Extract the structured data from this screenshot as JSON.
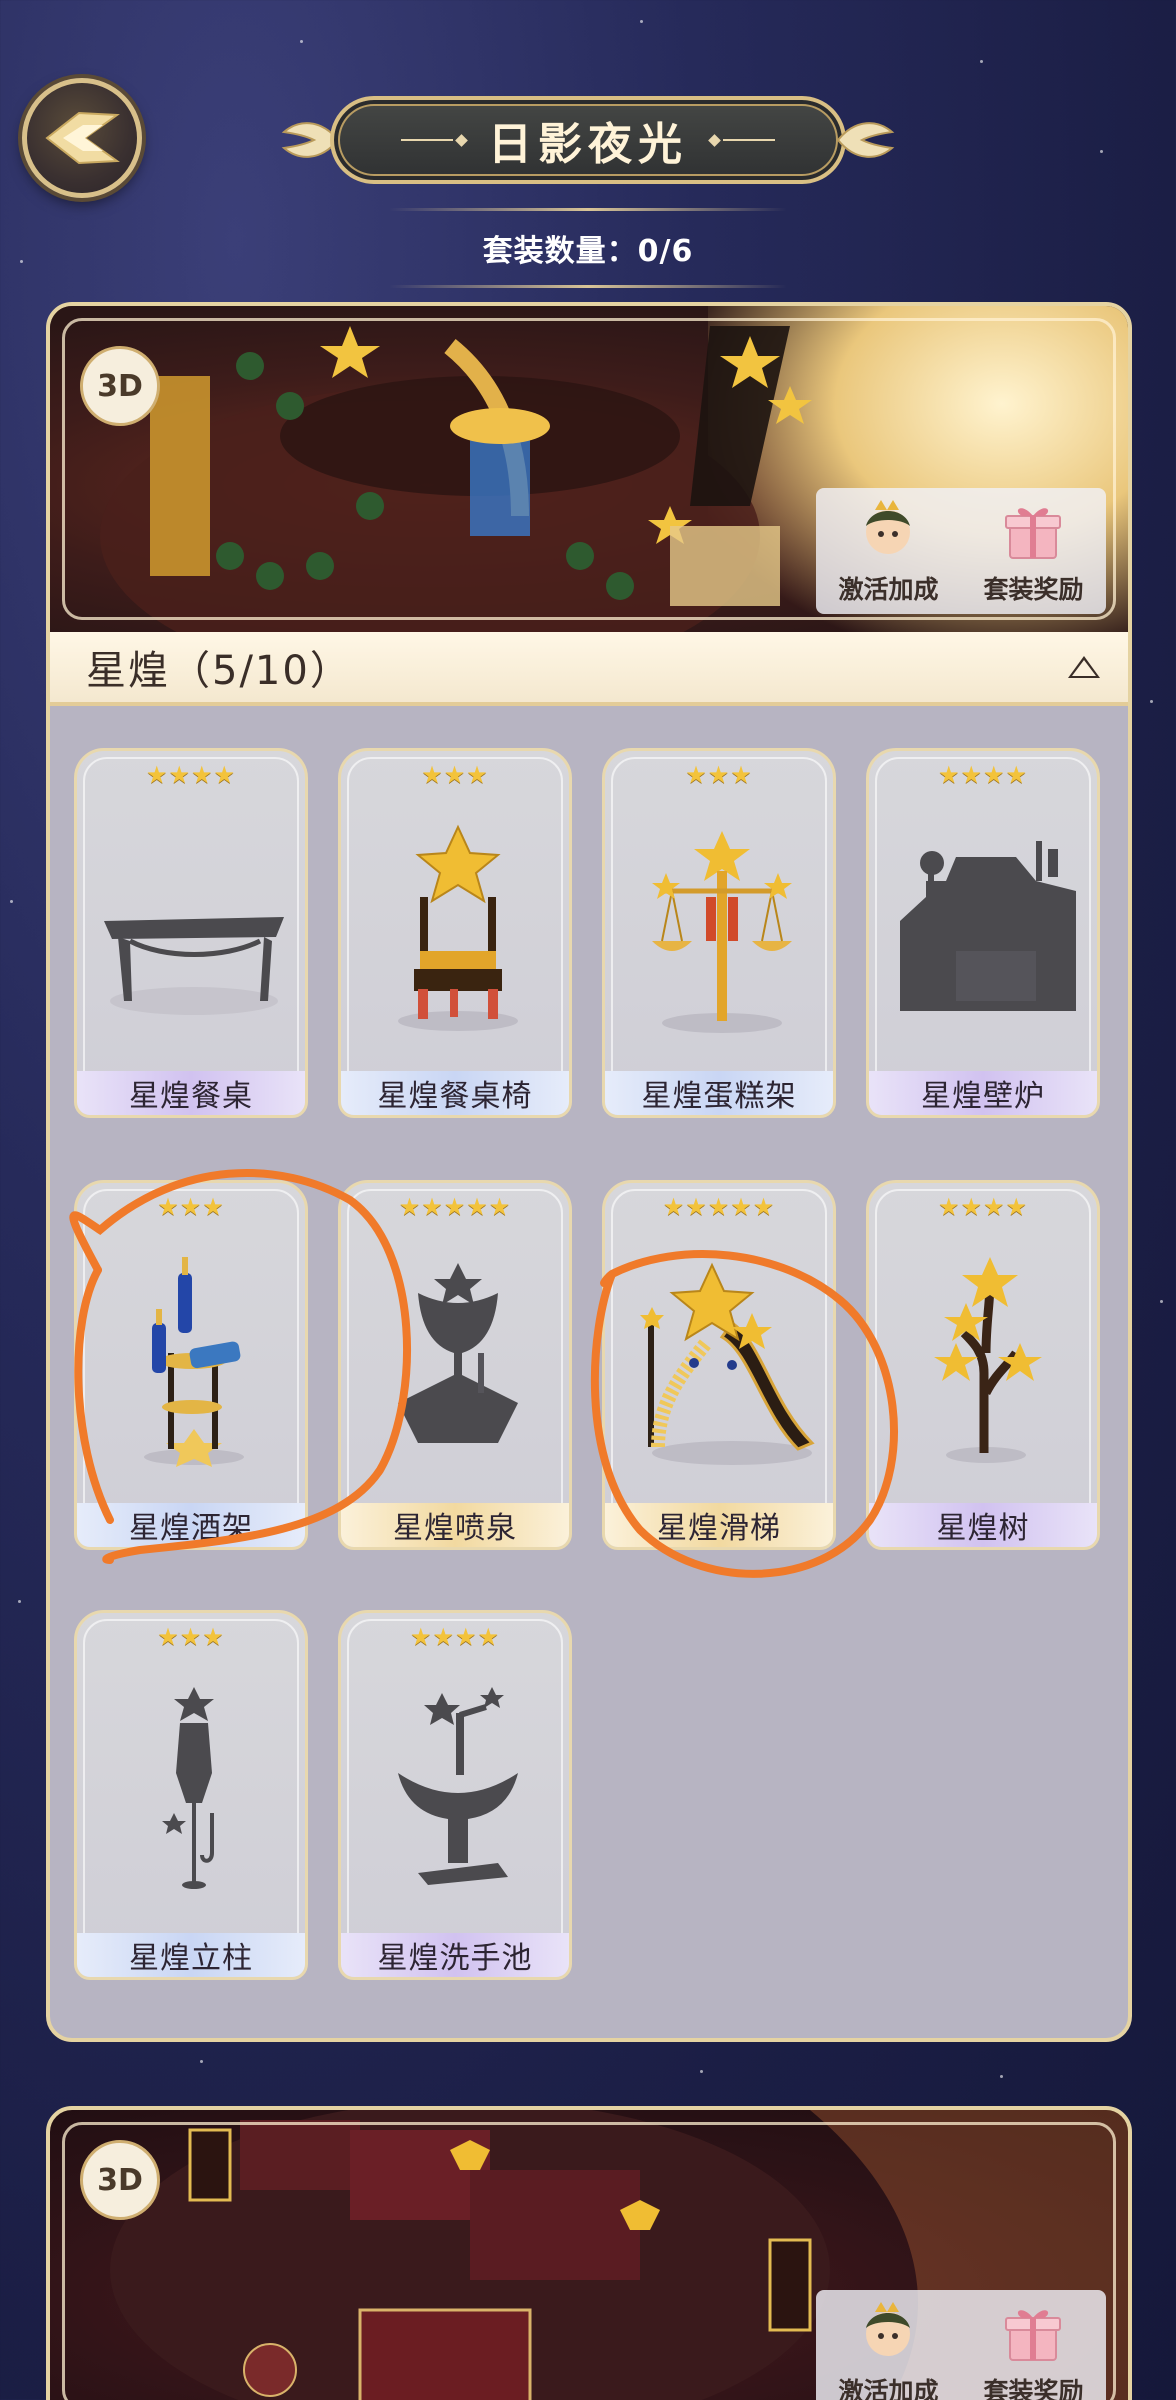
{
  "header": {
    "title": "日影夜光",
    "set_count_label": "套装数量：0/6",
    "back_icon": "back-arrow-icon"
  },
  "banner": {
    "badge_3d": "3D",
    "actions": [
      {
        "label": "激活加成",
        "icon": "elf-avatar-icon"
      },
      {
        "label": "套装奖励",
        "icon": "gift-box-icon"
      }
    ]
  },
  "section": {
    "title": "星煌（5/10）",
    "toggle_icon": "collapse-arrow-icon"
  },
  "items": [
    {
      "name": "星煌餐桌",
      "stars": "★★★★",
      "owned": false,
      "label_color": "purple"
    },
    {
      "name": "星煌餐桌椅",
      "stars": "★★★",
      "owned": true,
      "label_color": "blue"
    },
    {
      "name": "星煌蛋糕架",
      "stars": "★★★",
      "owned": true,
      "label_color": "blue"
    },
    {
      "name": "星煌壁炉",
      "stars": "★★★★",
      "owned": false,
      "label_color": "purple"
    },
    {
      "name": "星煌酒架",
      "stars": "★★★",
      "owned": true,
      "label_color": "blue"
    },
    {
      "name": "星煌喷泉",
      "stars": "★★★★★",
      "owned": false,
      "label_color": "gold"
    },
    {
      "name": "星煌滑梯",
      "stars": "★★★★★",
      "owned": true,
      "label_color": "gold"
    },
    {
      "name": "星煌树",
      "stars": "★★★★",
      "owned": true,
      "label_color": "purple"
    },
    {
      "name": "星煌立柱",
      "stars": "★★★",
      "owned": false,
      "label_color": "blue"
    },
    {
      "name": "星煌洗手池",
      "stars": "★★★★",
      "owned": false,
      "label_color": "purple"
    }
  ],
  "banner2": {
    "badge_3d": "3D",
    "actions": [
      {
        "label": "激活加成",
        "icon": "elf-avatar-icon"
      },
      {
        "label": "套装奖励",
        "icon": "gift-box-icon"
      }
    ]
  },
  "colors": {
    "background": "#262a5a",
    "gold_border": "#e5d3a2",
    "annotation": "#f07a2a",
    "star": "#f3c33b"
  }
}
